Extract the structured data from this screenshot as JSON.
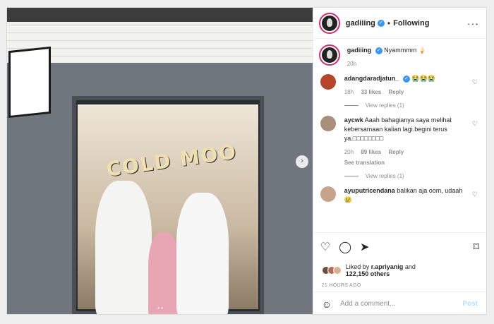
{
  "post": {
    "username": "gadiiing",
    "follow_label": "Following",
    "caption_user": "gadiiing",
    "caption": "Nyammmm 🍦",
    "caption_time": "20h",
    "photo_sign_text": "COLD MOO"
  },
  "comments": [
    {
      "user": "adangdaradjatun_",
      "verified": true,
      "text": "😭😭😭",
      "time": "18h",
      "likes": "33 likes",
      "reply": "Reply",
      "view_replies": "View replies (1)",
      "avatar_color": "#b5452b"
    },
    {
      "user": "aycwk",
      "verified": false,
      "text": "Aaah bahagianya saya melihat kebersamaan kalian lagi.begini terus ya.□□□□□□□□",
      "time": "20h",
      "likes": "89 likes",
      "reply": "Reply",
      "see_translation": "See translation",
      "view_replies": "View replies (1)",
      "avatar_color": "#a98e7a"
    },
    {
      "user": "ayuputricendana",
      "verified": false,
      "text": "balikan aja oom, udaah 😢",
      "avatar_color": "#c7a389"
    }
  ],
  "likes": {
    "prefix": "Liked by",
    "user": "r.apriyanig",
    "and": "and",
    "count": "122,150 others"
  },
  "timestamp": "21 HOURS AGO",
  "add_comment": {
    "placeholder": "Add a comment...",
    "post_label": "Post"
  },
  "colors": {
    "verified": "#3897f0",
    "text": "#262626",
    "muted": "#8e8e8e",
    "post_disabled": "#b2dffc"
  }
}
